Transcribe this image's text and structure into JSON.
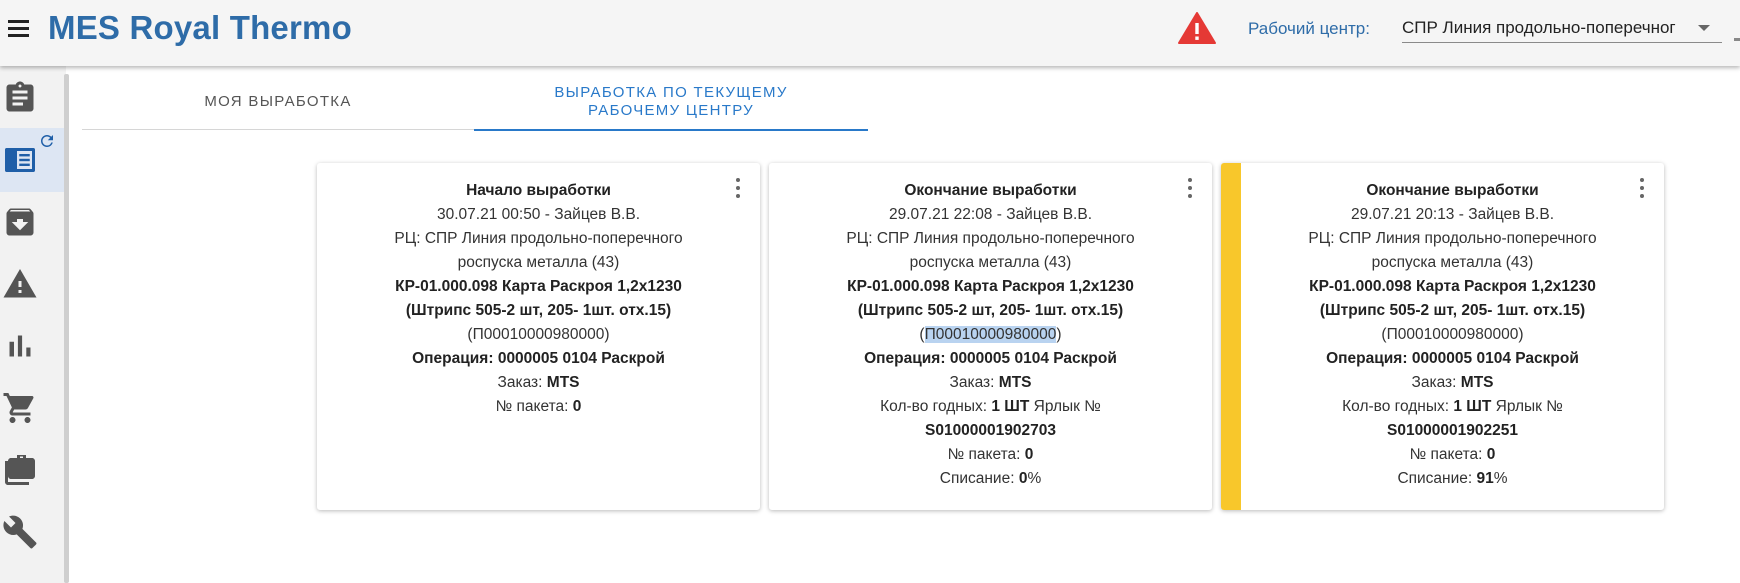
{
  "header": {
    "app_title": "MES Royal Thermo",
    "work_center_label": "Рабочий центр:",
    "work_center_value": "СПР Линия продольно-поперечног"
  },
  "sidebar": {
    "items": [
      {
        "icon": "clipboard-icon"
      },
      {
        "icon": "list-refresh-icon",
        "active": true
      },
      {
        "icon": "archive-icon"
      },
      {
        "icon": "warning-icon"
      },
      {
        "icon": "bar-chart-icon"
      },
      {
        "icon": "cart-icon"
      },
      {
        "icon": "briefcase-icon"
      },
      {
        "icon": "wrench-icon"
      }
    ]
  },
  "tabs": [
    {
      "label": "МОЯ ВЫРАБОТКА",
      "active": false
    },
    {
      "label": "ВЫРАБОТКА ПО ТЕКУЩЕМУ РАБОЧЕМУ ЦЕНТРУ",
      "active": true
    }
  ],
  "cards": [
    {
      "title": "Начало выработки",
      "datetime_user": "30.07.21 00:50 - Зайцев В.В.",
      "rc_line1": "РЦ: СПР Линия продольно-поперечного",
      "rc_line2": "роспуска металла (43)",
      "map_line1": "КР-01.000.098 Карта Раскроя 1,2х1230",
      "map_line2": "(Штрипс 505-2 шт, 205- 1шт. отх.15)",
      "code": "П00010000980000",
      "code_prefix": "(",
      "code_suffix": ")",
      "operation": "Операция: 0000005 0104 Раскрой",
      "order_label": "Заказ:",
      "order_value": "MTS",
      "package_label": "№ пакета:",
      "package_value": "0"
    },
    {
      "title": "Окончание выработки",
      "datetime_user": "29.07.21 22:08 - Зайцев В.В.",
      "rc_line1": "РЦ: СПР Линия продольно-поперечного",
      "rc_line2": "роспуска металла (43)",
      "map_line1": "КР-01.000.098 Карта Раскроя 1,2х1230",
      "map_line2": "(Штрипс 505-2 шт, 205- 1шт. отх.15)",
      "code": "П00010000980000",
      "code_prefix": "(",
      "code_suffix": ")",
      "operation": "Операция: 0000005 0104 Раскрой",
      "order_label": "Заказ:",
      "order_value": "MTS",
      "qty_label": "Кол-во годных:",
      "qty_value": "1 ШТ",
      "label_no": "Ярлык №",
      "label_value": "S01000001902703",
      "package_label": "№ пакета:",
      "package_value": "0",
      "writeoff_label": "Списание:",
      "writeoff_value": "0",
      "writeoff_unit": "%"
    },
    {
      "title": "Окончание выработки",
      "datetime_user": "29.07.21 20:13 - Зайцев В.В.",
      "rc_line1": "РЦ: СПР Линия продольно-поперечного",
      "rc_line2": "роспуска металла (43)",
      "map_line1": "КР-01.000.098 Карта Раскроя 1,2х1230",
      "map_line2": "(Штрипс 505-2 шт, 205- 1шт. отх.15)",
      "code": "П00010000980000",
      "code_prefix": "(",
      "code_suffix": ")",
      "operation": "Операция: 0000005 0104 Раскрой",
      "order_label": "Заказ:",
      "order_value": "MTS",
      "qty_label": "Кол-во годных:",
      "qty_value": "1 ШТ",
      "label_no": "Ярлык №",
      "label_value": "S01000001902251",
      "package_label": "№ пакета:",
      "package_value": "0",
      "writeoff_label": "Списание:",
      "writeoff_value": "91",
      "writeoff_unit": "%"
    }
  ],
  "colors": {
    "brand": "#2e6ca8",
    "tab_active": "#2979c9",
    "warning": "#e53935",
    "stripe": "#f8c72b"
  }
}
